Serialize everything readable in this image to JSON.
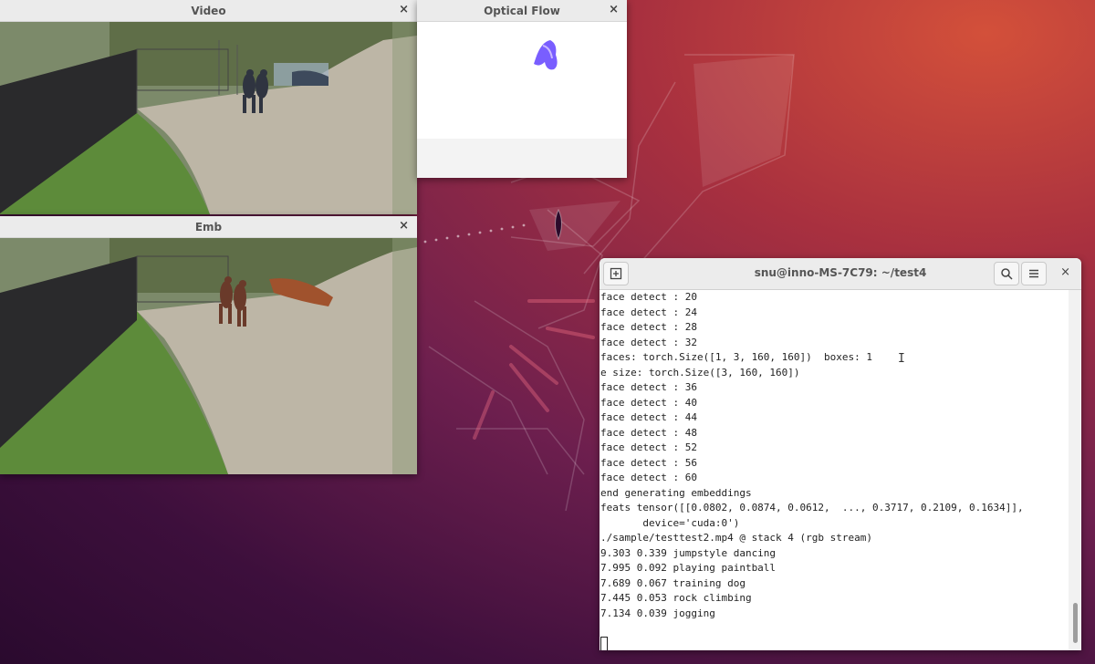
{
  "windows": {
    "video": {
      "title": "Video",
      "close": "×"
    },
    "flow": {
      "title": "Optical Flow",
      "close": "×"
    },
    "emb": {
      "title": "Emb",
      "close": "×"
    }
  },
  "terminal": {
    "title": "snu@inno-MS-7C79: ~/test4",
    "close": "×",
    "lines": [
      "face detect : 20",
      "face detect : 24",
      "face detect : 28",
      "face detect : 32",
      "faces: torch.Size([1, 3, 160, 160])  boxes: 1",
      "e size: torch.Size([3, 160, 160])",
      "face detect : 36",
      "face detect : 40",
      "face detect : 44",
      "face detect : 48",
      "face detect : 52",
      "face detect : 56",
      "face detect : 60",
      "end generating embeddings",
      "feats tensor([[0.0802, 0.0874, 0.0612,  ..., 0.3717, 0.2109, 0.1634]],",
      "       device='cuda:0')",
      "./sample/testtest2.mp4 @ stack 4 (rgb stream)",
      "9.303 0.339 jumpstyle dancing",
      "7.995 0.092 playing paintball",
      "7.689 0.067 training dog",
      "7.445 0.053 rock climbing",
      "7.134 0.039 jogging"
    ]
  },
  "colors": {
    "desktop_accent": "#a8303f",
    "titlebar": "#ebebeb",
    "flow_blob": "#6a4cff"
  }
}
